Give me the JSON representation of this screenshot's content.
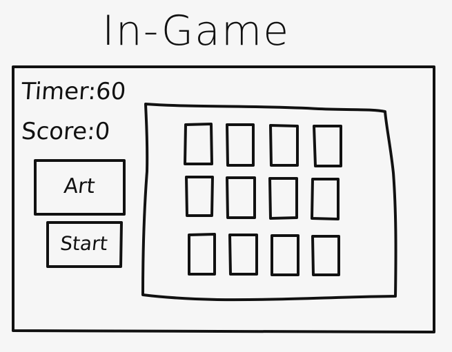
{
  "title": "In-Game",
  "hud": {
    "timer_label": "Timer:60",
    "score_label": "Score:0"
  },
  "buttons": {
    "art": "Art",
    "start": "Start"
  },
  "board": {
    "rows": 3,
    "columns": 4
  }
}
